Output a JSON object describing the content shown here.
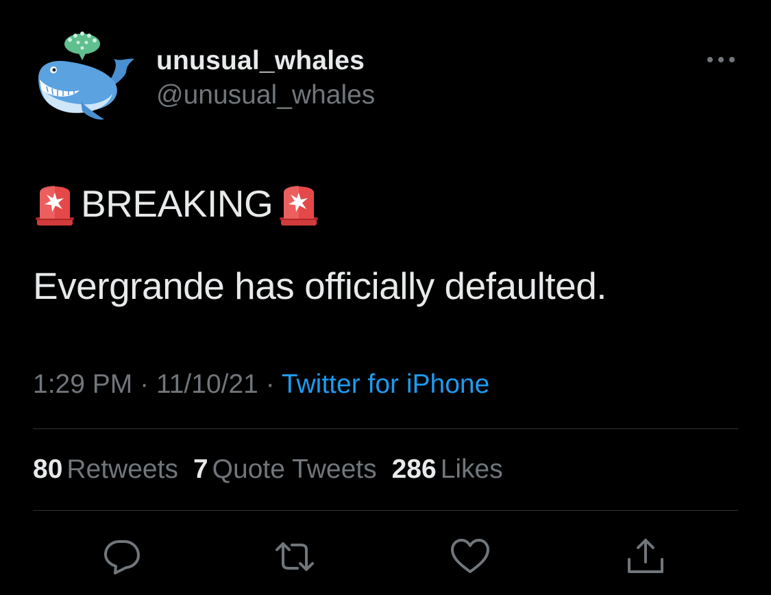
{
  "author": {
    "display_name": "unusual_whales",
    "handle": "@unusual_whales",
    "avatar_icon": "whale-icon"
  },
  "tweet": {
    "breaking_word": "BREAKING",
    "siren_icon": "police-siren-icon",
    "body": "Evergrande has officially defaulted."
  },
  "meta": {
    "time": "1:29 PM",
    "separator": "·",
    "date": "11/10/21",
    "source": "Twitter for iPhone"
  },
  "stats": {
    "retweets_count": "80",
    "retweets_label": "Retweets",
    "quotes_count": "7",
    "quotes_label": "Quote Tweets",
    "likes_count": "286",
    "likes_label": "Likes"
  },
  "actions": {
    "reply_icon": "reply-icon",
    "retweet_icon": "retweet-icon",
    "like_icon": "heart-icon",
    "share_icon": "share-icon",
    "more_icon": "more-icon"
  },
  "colors": {
    "background": "#000000",
    "primary_text": "#e7e9ea",
    "secondary_text": "#71767b",
    "link": "#1d9bf0",
    "divider": "#2f3336"
  }
}
